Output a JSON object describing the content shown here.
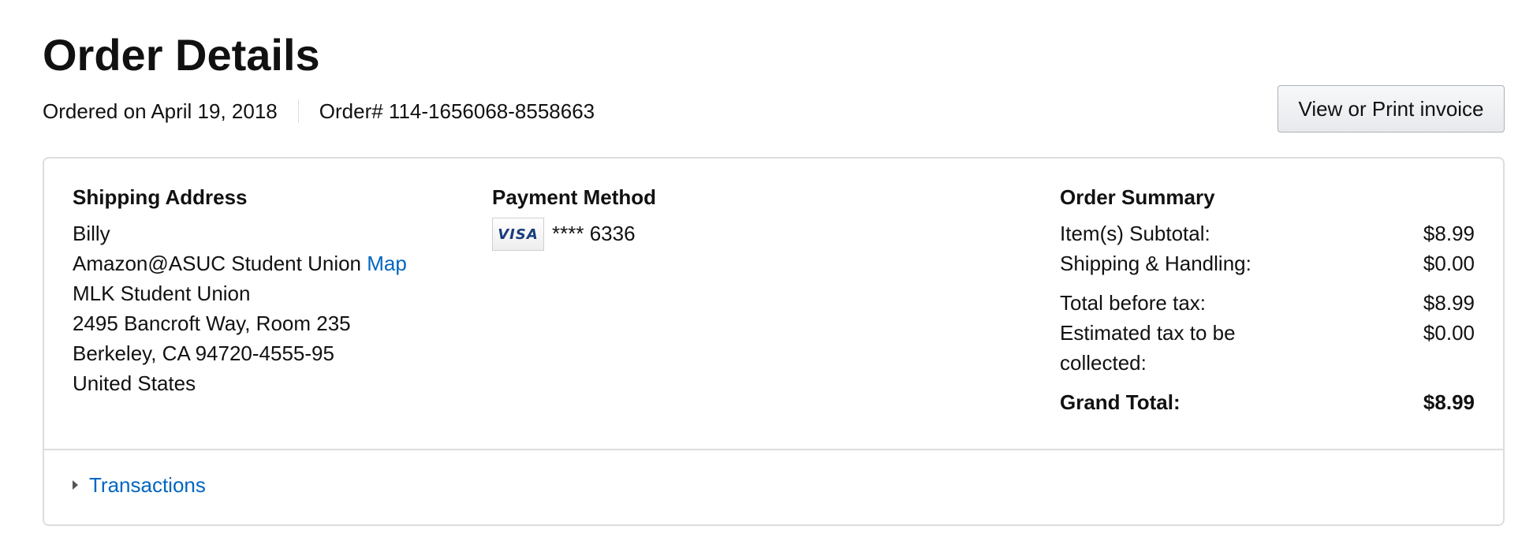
{
  "page": {
    "title": "Order Details"
  },
  "order_meta": {
    "ordered_on": "Ordered on April 19, 2018",
    "order_number": "Order# 114-1656068-8558663"
  },
  "invoice_button": {
    "label": "View or Print invoice"
  },
  "shipping": {
    "heading": "Shipping Address",
    "name": "Billy",
    "line1": "Amazon@ASUC Student Union",
    "map_link": "Map",
    "line2": "MLK Student Union",
    "line3": "2495 Bancroft Way, Room 235",
    "line4": "Berkeley, CA 94720-4555-95",
    "country": "United States"
  },
  "payment": {
    "heading": "Payment Method",
    "card_brand": "VISA",
    "card_number": "**** 6336",
    "card_icon": "visa-card-icon"
  },
  "summary": {
    "heading": "Order Summary",
    "subtotal_label": "Item(s) Subtotal:",
    "subtotal_value": "$8.99",
    "shipping_label": "Shipping & Handling:",
    "shipping_value": "$0.00",
    "before_tax_label": "Total before tax:",
    "before_tax_value": "$8.99",
    "tax_label_line1": "Estimated tax to be",
    "tax_label_line2": "collected:",
    "tax_value": "$0.00",
    "grand_total_label": "Grand Total:",
    "grand_total_value": "$8.99"
  },
  "transactions": {
    "label": "Transactions",
    "icon": "caret-right-icon"
  },
  "colors": {
    "link": "#0066c0",
    "border": "#dddddd",
    "text": "#111111"
  }
}
